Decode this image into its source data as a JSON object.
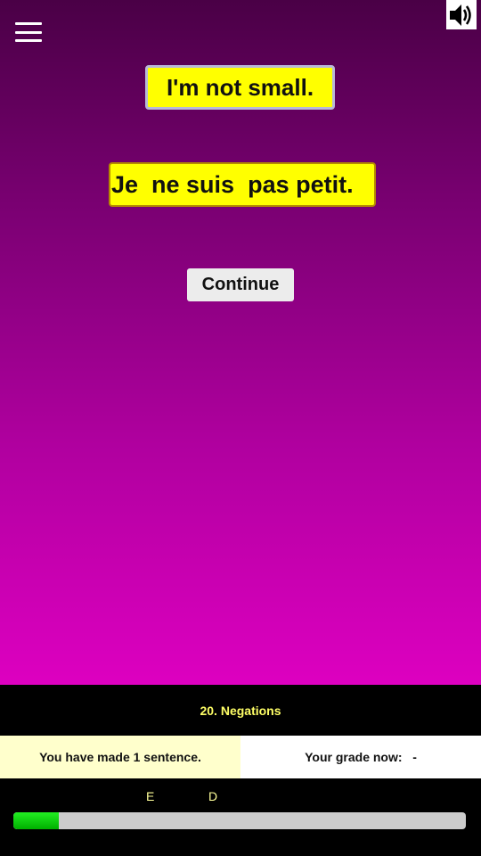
{
  "menu": {
    "icon": "hamburger-menu-icon"
  },
  "sound": {
    "icon": "speaker-volume-icon"
  },
  "prompt": {
    "english": "I'm not small.",
    "french": "Je  ne suis  pas petit."
  },
  "continue_label": "Continue",
  "lesson": {
    "title": "20. Negations"
  },
  "stats": {
    "made": "You have made 1 sentence.",
    "grade_label": "Your grade now:   -"
  },
  "grade_marks": [
    "E",
    "D"
  ],
  "progress": {
    "fraction": 0.1
  },
  "colors": {
    "card_bg": "#ffff00",
    "gradient_top": "#4a0046",
    "gradient_bottom": "#dd00c0",
    "progress_fill": "#00c800"
  }
}
